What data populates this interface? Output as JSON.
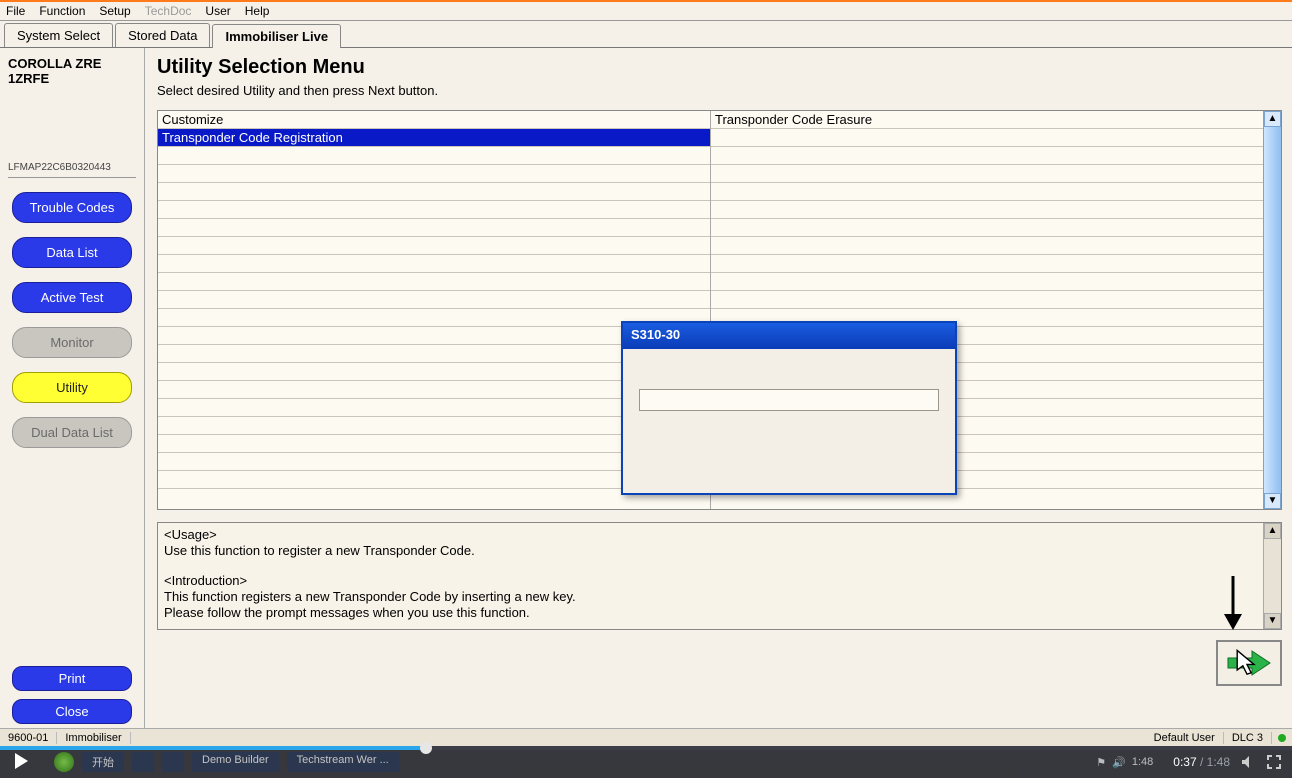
{
  "menu": {
    "file": "File",
    "function": "Function",
    "setup": "Setup",
    "techdoc": "TechDoc",
    "user": "User",
    "help": "Help"
  },
  "tabs": {
    "system_select": "System Select",
    "stored_data": "Stored Data",
    "immobiliser_live": "Immobiliser Live"
  },
  "sidebar": {
    "vehicle_line1": "COROLLA ZRE",
    "vehicle_line2": "1ZRFE",
    "vin": "LFMAP22C6B0320443",
    "buttons": {
      "trouble_codes": "Trouble Codes",
      "data_list": "Data List",
      "active_test": "Active Test",
      "monitor": "Monitor",
      "utility": "Utility",
      "dual_data_list": "Dual Data List",
      "print": "Print",
      "close": "Close"
    }
  },
  "main": {
    "title": "Utility Selection Menu",
    "subtitle": "Select desired Utility and then press Next button.",
    "grid": {
      "col1": [
        "Customize",
        "Transponder Code Registration"
      ],
      "col2": [
        "Transponder Code Erasure"
      ],
      "selected": "Transponder Code Registration"
    },
    "description": {
      "usage_header": "<Usage>",
      "usage_text": "Use this function to register a new Transponder Code.",
      "intro_header": "<Introduction>",
      "intro_text1": "This function registers a new Transponder Code by inserting a new key.",
      "intro_text2": "Please follow the prompt messages when you use this function."
    }
  },
  "popup": {
    "title": "S310-30"
  },
  "status": {
    "left1": "9600-01",
    "left2": "Immobiliser",
    "user": "Default User",
    "dlc": "DLC 3"
  },
  "player": {
    "current": "0:37",
    "total": "1:48",
    "task_items": [
      "开始",
      "",
      "",
      "Demo Builder",
      "Techstream Wer ..."
    ],
    "clock": "1:48"
  }
}
